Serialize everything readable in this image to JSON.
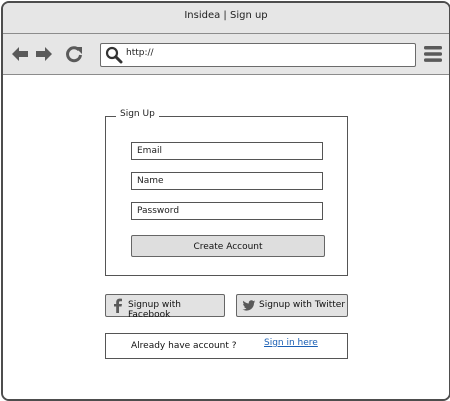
{
  "window": {
    "title": "Insidea | Sign up"
  },
  "nav": {
    "back_icon": "back-arrow-icon",
    "forward_icon": "forward-arrow-icon",
    "reload_icon": "reload-icon",
    "search_icon": "search-icon",
    "menu_icon": "hamburger-menu-icon",
    "address": "http://"
  },
  "signup": {
    "legend": "Sign Up",
    "email_placeholder": "Email",
    "name_placeholder": "Name",
    "password_placeholder": "Password",
    "create_button": "Create Account"
  },
  "social": {
    "facebook_label": "Signup with Facebook",
    "facebook_icon": "facebook-icon",
    "twitter_label": "Signup with Twitter",
    "twitter_icon": "twitter-icon"
  },
  "signin": {
    "prompt": "Already have account ?",
    "link": "Sign in here"
  },
  "colors": {
    "chrome": "#e6e6e6",
    "border": "#4d4d4d",
    "button": "#dedede",
    "link": "#1a5fb4"
  }
}
